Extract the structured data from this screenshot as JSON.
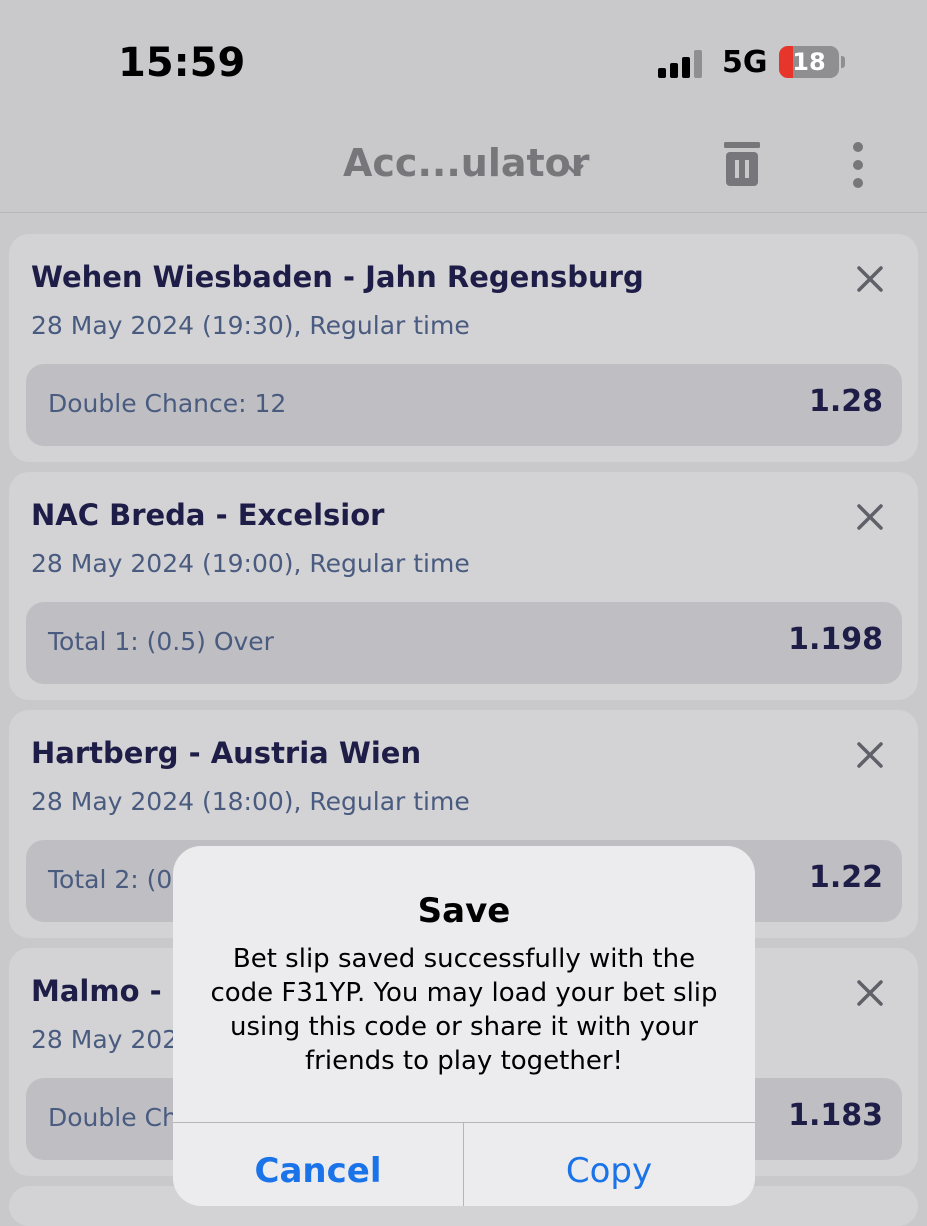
{
  "status_bar": {
    "time": "15:59",
    "network": "5G",
    "battery_level": "18",
    "battery_color": "#e8352b"
  },
  "header": {
    "title": "Acc...ulator",
    "icons": [
      "chevron-down-icon",
      "trash-icon",
      "more-vertical-icon"
    ]
  },
  "bets": [
    {
      "match": "Wehen Wiesbaden - Jahn Regensburg",
      "date": "28 May 2024 (19:30), Regular time",
      "market": "Double Chance: 12",
      "odds": "1.28"
    },
    {
      "match": "NAC Breda - Excelsior",
      "date": "28 May 2024 (19:00), Regular time",
      "market": "Total 1: (0.5) Over",
      "odds": "1.198"
    },
    {
      "match": "Hartberg - Austria Wien",
      "date": "28 May 2024 (18:00), Regular time",
      "market": "Total 2: (0",
      "odds": "1.22"
    },
    {
      "match": "Malmo - E",
      "date": "28 May 202",
      "market": "Double Ch",
      "odds": "1.183"
    }
  ],
  "dialog": {
    "title": "Save",
    "message": "Bet slip saved successfully with the code F31YP. You may load your bet slip using this code or share it with your friends to play together!",
    "cancel_label": "Cancel",
    "copy_label": "Copy",
    "accent_color": "#1a73e8"
  }
}
